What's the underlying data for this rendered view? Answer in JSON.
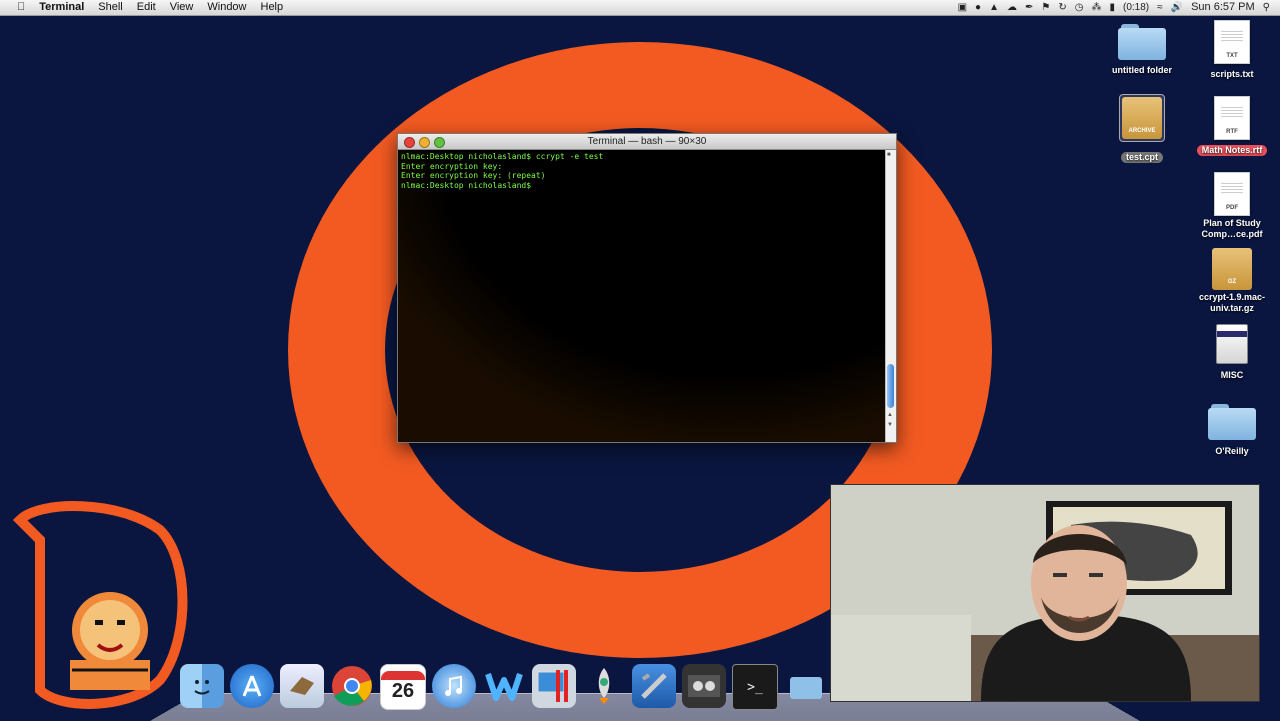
{
  "menubar": {
    "apple_icon": "apple-icon",
    "app_name": "Terminal",
    "menus": [
      "Shell",
      "Edit",
      "View",
      "Window",
      "Help"
    ],
    "battery": "(0:18)",
    "clock": "Sun 6:57 PM"
  },
  "terminal": {
    "title": "Terminal — bash — 90×30",
    "lines": [
      "nlmac:Desktop nicholasland$ ccrypt -e test",
      "Enter encryption key:",
      "Enter encryption key: (repeat)",
      "nlmac:Desktop nicholasland$"
    ]
  },
  "desktop": {
    "icons": [
      {
        "label": "untitled folder",
        "kind": "folder"
      },
      {
        "label": "scripts.txt",
        "kind": "doc",
        "ext": "TXT"
      },
      {
        "label": "test.cpt",
        "kind": "archive",
        "ext": "ARCHIVE"
      },
      {
        "label": "Math Notes.rtf",
        "kind": "doc",
        "ext": "RTF"
      },
      {
        "label": "Plan of Study Comp…ce.pdf",
        "kind": "doc",
        "ext": "PDF"
      },
      {
        "label": "ccrypt-1.9.mac-univ.tar.gz",
        "kind": "archive",
        "ext": "GZ"
      },
      {
        "label": "MISC",
        "kind": "drive"
      },
      {
        "label": "O'Reilly",
        "kind": "folder"
      }
    ]
  },
  "dock": {
    "items": [
      "finder-icon",
      "app-store-icon",
      "mail-icon",
      "chrome-icon",
      "calendar-icon",
      "itunes-icon",
      "word-icon",
      "system-prefs-icon",
      "launchpad-icon",
      "xcode-icon",
      "photo-booth-icon",
      "terminal-icon"
    ],
    "calendar_day": "26"
  },
  "colors": {
    "desktop_bg": "#0a1640",
    "ring": "#f25a22",
    "terminal_text": "#7CFC4A",
    "label_highlight": "#e8505a"
  }
}
